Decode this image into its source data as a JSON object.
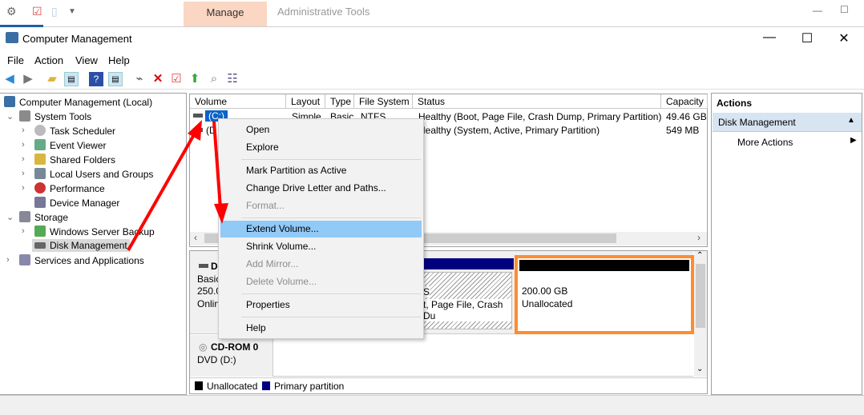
{
  "ribbon": {
    "tabs": [
      {
        "label": "Manage"
      },
      {
        "label": "Administrative Tools"
      }
    ]
  },
  "window": {
    "title": "Computer Management",
    "minimize": "—",
    "maximize": "☐",
    "close": "✕"
  },
  "menubar": [
    "File",
    "Action",
    "View",
    "Help"
  ],
  "tree": {
    "root": "Computer Management (Local)",
    "system_tools": "System Tools",
    "system_children": [
      "Task Scheduler",
      "Event Viewer",
      "Shared Folders",
      "Local Users and Groups",
      "Performance",
      "Device Manager"
    ],
    "storage": "Storage",
    "storage_children": [
      "Windows Server Backup",
      "Disk Management"
    ],
    "services": "Services and Applications"
  },
  "volume_list": {
    "columns": [
      "Volume",
      "Layout",
      "Type",
      "File System",
      "Status",
      "Capacity"
    ],
    "rows": [
      {
        "volume": "(C:)",
        "layout": "Simple",
        "type": "Basic",
        "fs": "NTFS",
        "status": "Healthy (Boot, Page File, Crash Dump, Primary Partition)",
        "capacity": "49.46 GB"
      },
      {
        "volume": "(D",
        "layout": "",
        "type": "",
        "fs": "",
        "status": "Healthy (System, Active, Primary Partition)",
        "capacity": "549 MB"
      }
    ]
  },
  "disks": [
    {
      "name": "D",
      "type": "Basic",
      "size": "250.0",
      "state": "Onlin",
      "partition_fragment_1": "S",
      "partition_fragment_2": "t, Page File, Crash Du",
      "unallocated_size": "200.00 GB",
      "unallocated_label": "Unallocated"
    },
    {
      "name": "CD-ROM 0",
      "type": "DVD (D:)"
    }
  ],
  "legend": [
    {
      "label": "Unallocated",
      "color": "#000000"
    },
    {
      "label": "Primary partition",
      "color": "#000080"
    }
  ],
  "actions": {
    "title": "Actions",
    "section": "Disk Management",
    "more": "More Actions"
  },
  "context_menu": {
    "items": [
      {
        "label": "Open",
        "disabled": false
      },
      {
        "label": "Explore",
        "disabled": false
      },
      {
        "label": "Mark Partition as Active",
        "disabled": false
      },
      {
        "label": "Change Drive Letter and Paths...",
        "disabled": false
      },
      {
        "label": "Format...",
        "disabled": true
      },
      {
        "label": "Extend Volume...",
        "disabled": false,
        "highlighted": true
      },
      {
        "label": "Shrink Volume...",
        "disabled": false
      },
      {
        "label": "Add Mirror...",
        "disabled": true
      },
      {
        "label": "Delete Volume...",
        "disabled": true
      },
      {
        "label": "Properties",
        "disabled": false
      },
      {
        "label": "Help",
        "disabled": false
      }
    ]
  },
  "colors": {
    "accent_highlight": "#91c9f7",
    "annotation_arrow": "#ff0000",
    "annotation_box": "#ff8c2e",
    "primary_partition": "#000080",
    "manage_tab": "#fbd6c2"
  }
}
